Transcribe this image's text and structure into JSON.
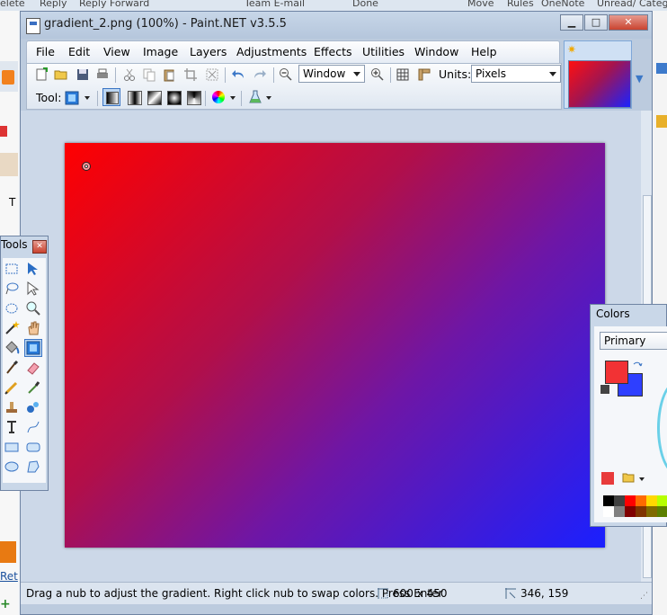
{
  "background": {
    "top_items": [
      "elete",
      "Reply",
      "Reply",
      "Forward",
      "Team E-mail",
      "Done",
      "Move",
      "Rules",
      "OneNote",
      "Unread/ Catego"
    ],
    "left_text_t": "T",
    "left_link": "Ret"
  },
  "window": {
    "title": "gradient_2.png (100%) - Paint.NET v3.5.5",
    "buttons": {
      "minimize": "▁",
      "maximize": "□",
      "close": "✕"
    }
  },
  "menu": [
    "File",
    "Edit",
    "View",
    "Image",
    "Layers",
    "Adjustments",
    "Effects",
    "Utilities",
    "Window",
    "Help"
  ],
  "toolbar": {
    "zoom_value": "Window",
    "units_label": "Units:",
    "units_value": "Pixels",
    "tool_label": "Tool:"
  },
  "status": {
    "message": "Drag a nub to adjust the gradient. Right click nub to swap colors. Press Enter",
    "image_size": "600 x 450",
    "cursor_position": "346, 159"
  },
  "tools_window": {
    "title": "Tools",
    "close": "✕",
    "tools": [
      "rectangle-select-icon",
      "move-selection-icon",
      "lasso-select-icon",
      "move-selected-icon",
      "ellipse-select-icon",
      "zoom-icon",
      "magic-wand-icon",
      "pan-icon",
      "paint-bucket-icon",
      "gradient-icon",
      "paintbrush-icon",
      "eraser-icon",
      "pencil-icon",
      "color-picker-icon",
      "clone-stamp-icon",
      "recolor-icon",
      "text-icon",
      "line-curve-icon",
      "rectangle-icon",
      "rounded-rectangle-icon",
      "ellipse-icon",
      "freeform-shape-icon"
    ],
    "selected_tool": "gradient-icon"
  },
  "colors_window": {
    "title": "Colors",
    "mode": "Primary",
    "primary_color": "#f23234",
    "secondary_color": "#2e3fff"
  },
  "canvas": {
    "gradient_start": "#ff0000",
    "gradient_end": "#1a20ff"
  }
}
